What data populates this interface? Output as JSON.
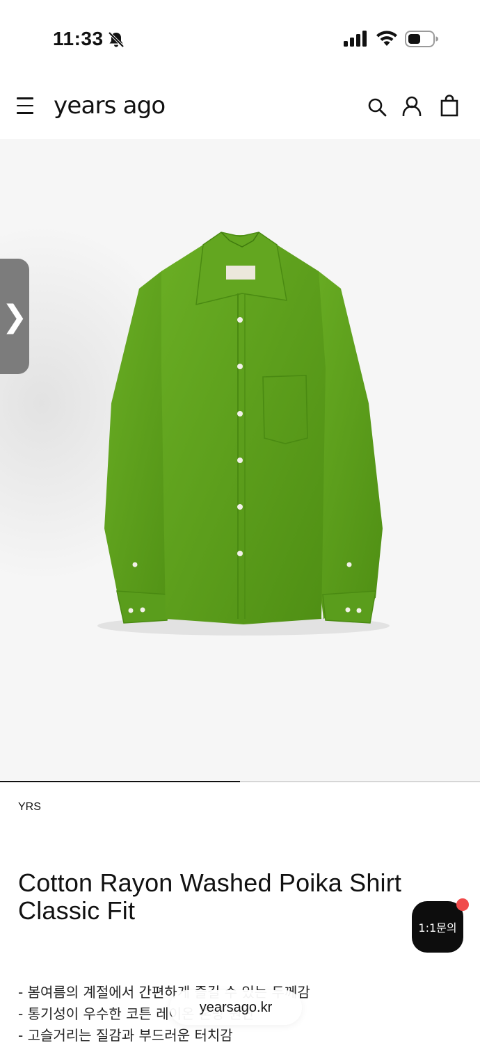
{
  "status_bar": {
    "time": "11:33",
    "icons": [
      "bell-slash-icon",
      "cellular-signal-icon",
      "wifi-icon",
      "battery-icon"
    ]
  },
  "header": {
    "logo": "years ago",
    "icons": [
      "menu-icon",
      "search-icon",
      "account-icon",
      "shopping-bag-icon"
    ]
  },
  "gallery": {
    "side_tab_glyph": "❯",
    "progress_fraction": 0.5,
    "shirt_color": "#5a9d1c"
  },
  "product": {
    "brand": "YRS",
    "title": "Cotton Rayon Washed Poika Shirt Classic Fit",
    "description": [
      "- 봄여름의 계절에서 간편하게 즐길 수 있는 두께감",
      "- 통기성이 우수한 코튼 레이온 혼방 원단",
      "- 고슬거리는 질감과 부드러운 터치감"
    ]
  },
  "chat": {
    "label": "1:1문의"
  },
  "browser": {
    "url": "yearsago.kr"
  }
}
